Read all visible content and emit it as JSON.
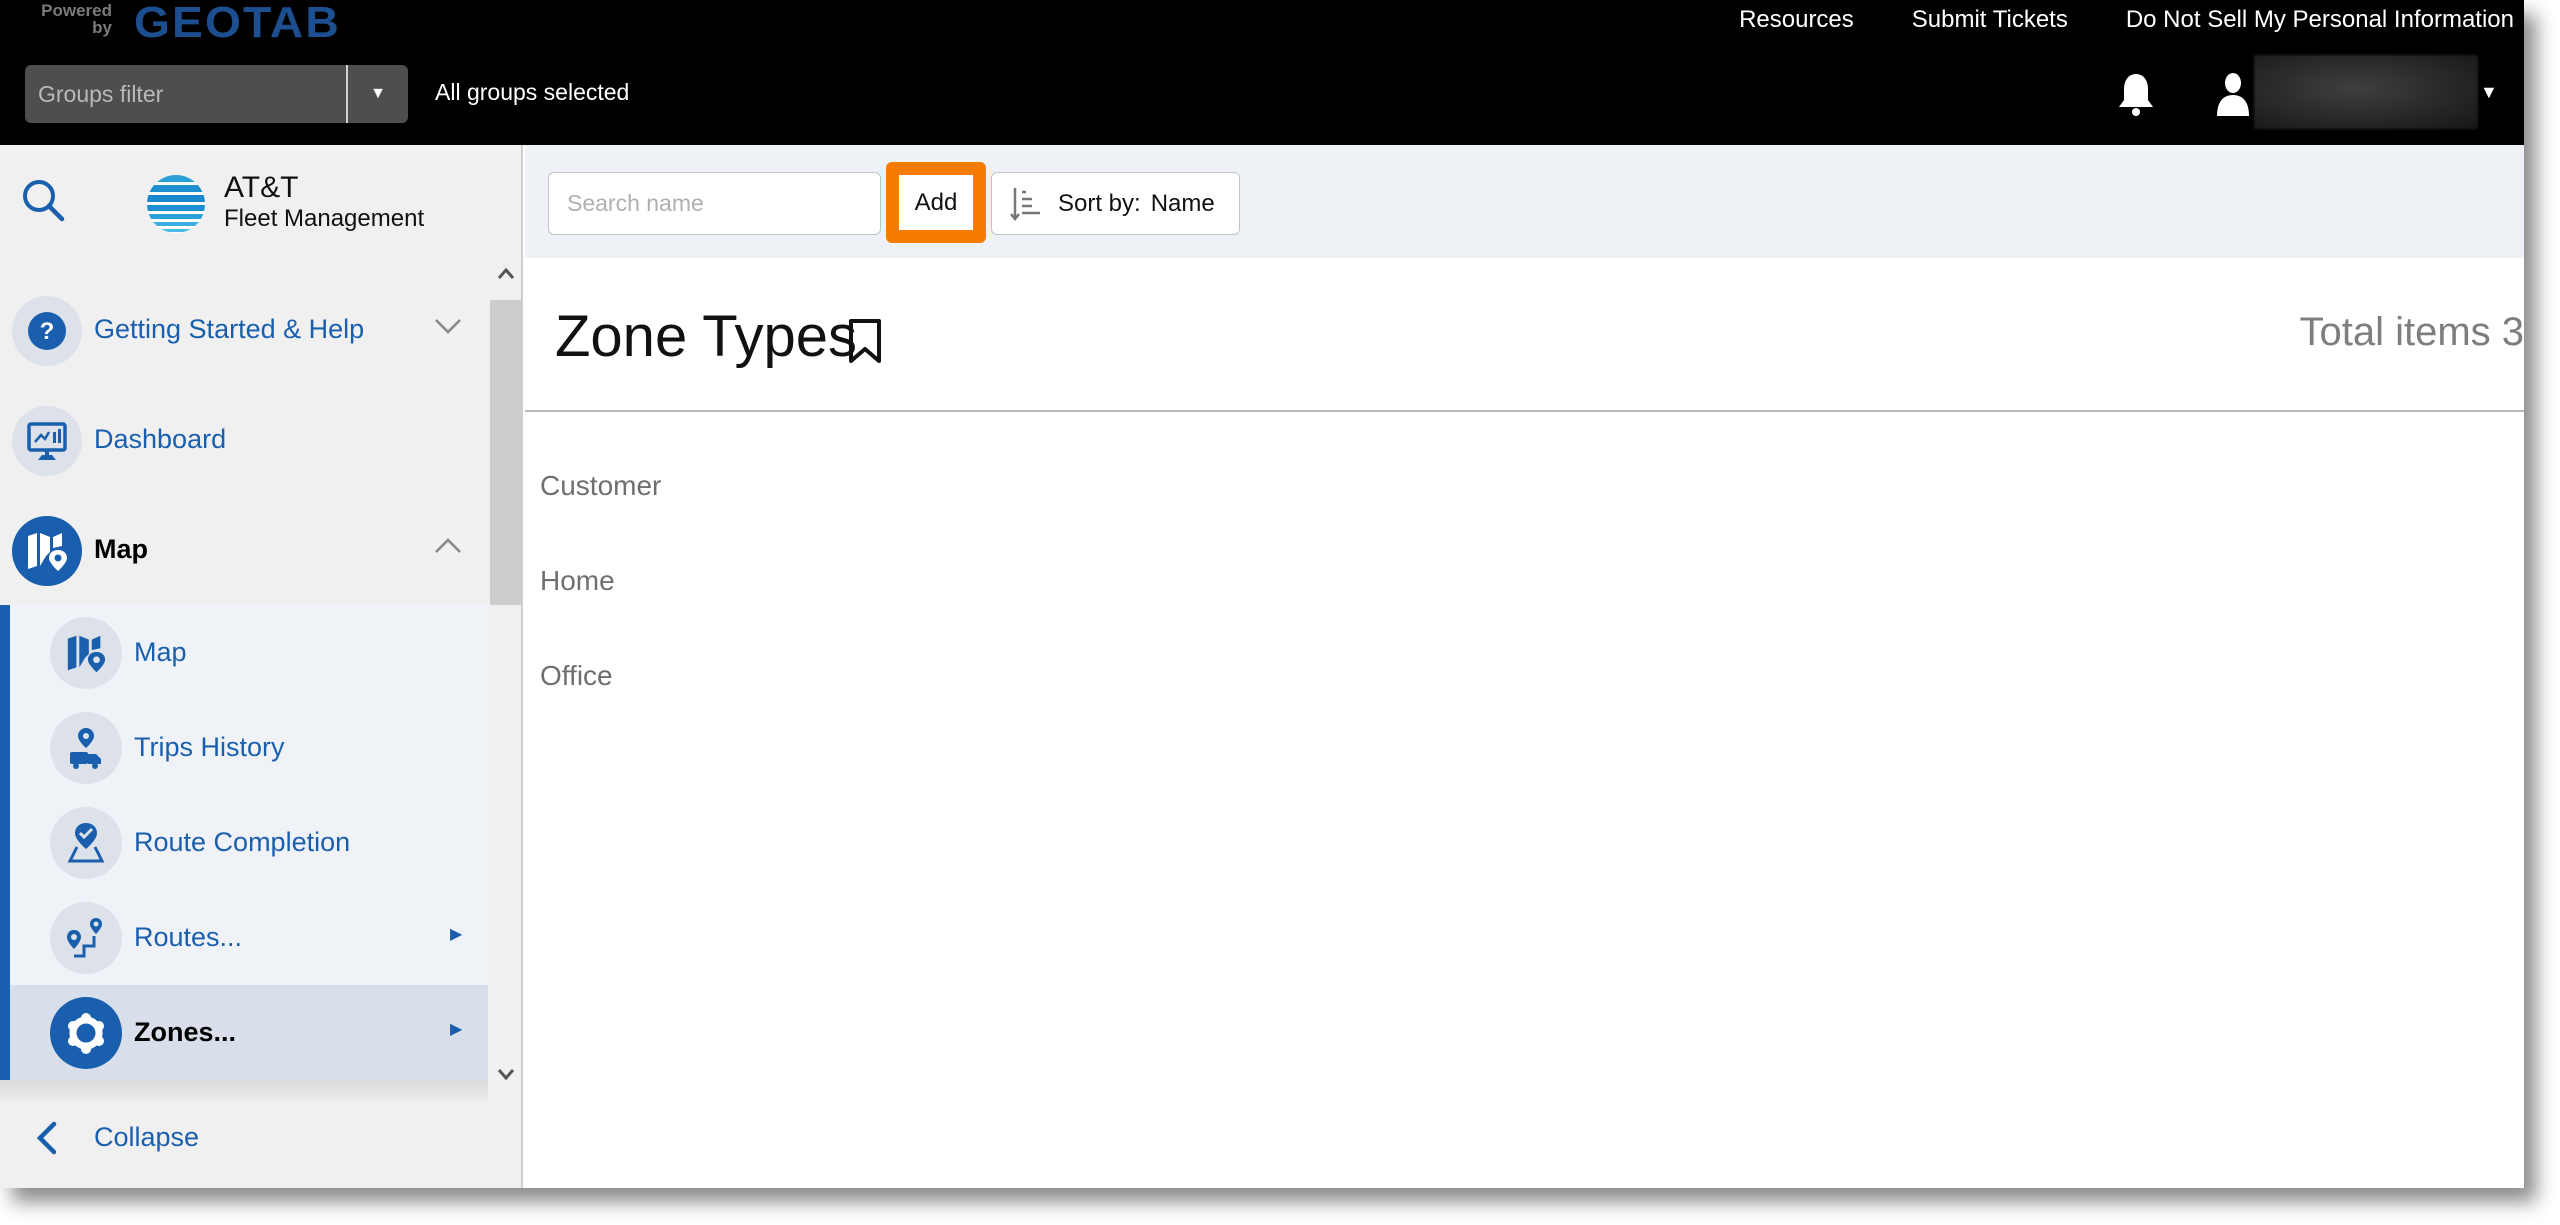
{
  "header": {
    "powered_by": "Powered by",
    "brand": "GEOTAB",
    "groups_filter": {
      "placeholder": "Groups filter",
      "status": "All groups selected"
    },
    "links": [
      "Resources",
      "Submit Tickets",
      "Do Not Sell My Personal Information"
    ],
    "user_name": ""
  },
  "sidebar": {
    "logo_title": "AT&T",
    "logo_subtitle": "Fleet Management",
    "items": [
      {
        "label": "Getting Started & Help",
        "icon": "help-icon",
        "expander": "chevron-down"
      },
      {
        "label": "Dashboard",
        "icon": "dashboard-icon"
      },
      {
        "label": "Map",
        "icon": "map-icon",
        "expander": "chevron-up",
        "expanded": true
      }
    ],
    "sub_items": [
      {
        "label": "Map",
        "icon": "map-icon"
      },
      {
        "label": "Trips History",
        "icon": "trips-history-icon"
      },
      {
        "label": "Route Completion",
        "icon": "route-completion-icon"
      },
      {
        "label": "Routes...",
        "icon": "routes-icon",
        "has_submenu": true
      },
      {
        "label": "Zones...",
        "icon": "zones-icon",
        "has_submenu": true,
        "active": true
      }
    ],
    "collapse_label": "Collapse"
  },
  "toolbar": {
    "search_placeholder": "Search name",
    "search_value": "",
    "add_label": "Add",
    "sort_label": "Sort by:",
    "sort_value": "Name",
    "highlight_color": "#f57c00"
  },
  "main": {
    "title": "Zone Types",
    "total_items": "Total items 3",
    "items": [
      "Customer",
      "Home",
      "Office"
    ]
  },
  "colors": {
    "accent": "#1a5fad",
    "header_bg": "#000000",
    "sidebar_bg": "#f0f0f0",
    "toolbar_bg": "#eef1f5"
  }
}
